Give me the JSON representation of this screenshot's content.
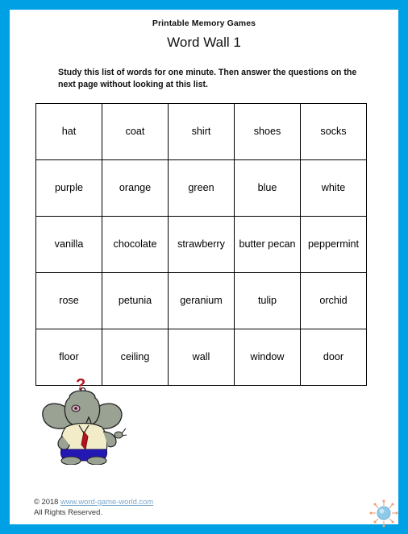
{
  "page": {
    "border_color": "#00A0E4",
    "background_color": "#ffffff"
  },
  "header": {
    "site_title": "Printable Memory Games",
    "worksheet_title": "Word Wall 1"
  },
  "instructions": {
    "text": "Study this list of words for one minute. Then answer the questions on the next page without looking at this list."
  },
  "word_table": {
    "rows": [
      [
        "hat",
        "coat",
        "shirt",
        "shoes",
        "socks"
      ],
      [
        "purple",
        "orange",
        "green",
        "blue",
        "white"
      ],
      [
        "vanilla",
        "chocolate",
        "strawberry",
        "butter pecan",
        "peppermint"
      ],
      [
        "rose",
        "petunia",
        "geranium",
        "tulip",
        "orchid"
      ],
      [
        "floor",
        "ceiling",
        "wall",
        "window",
        "door"
      ]
    ]
  },
  "illustration": {
    "name": "elephant-with-question-mark",
    "question_mark": "?",
    "colors": {
      "body": "#9aa294",
      "shirt": "#f2edc8",
      "tie": "#b4141e",
      "pants": "#2418b4",
      "question_mark": "#b4141e"
    }
  },
  "footer": {
    "copyright_prefix": "© 2018",
    "site_url": "www.word-game-world.com",
    "rights": "All Rights Reserved."
  },
  "logo": {
    "name": "sun-burst-logo",
    "center_color": "#8ec9e8",
    "ray_color": "#f0a070"
  }
}
